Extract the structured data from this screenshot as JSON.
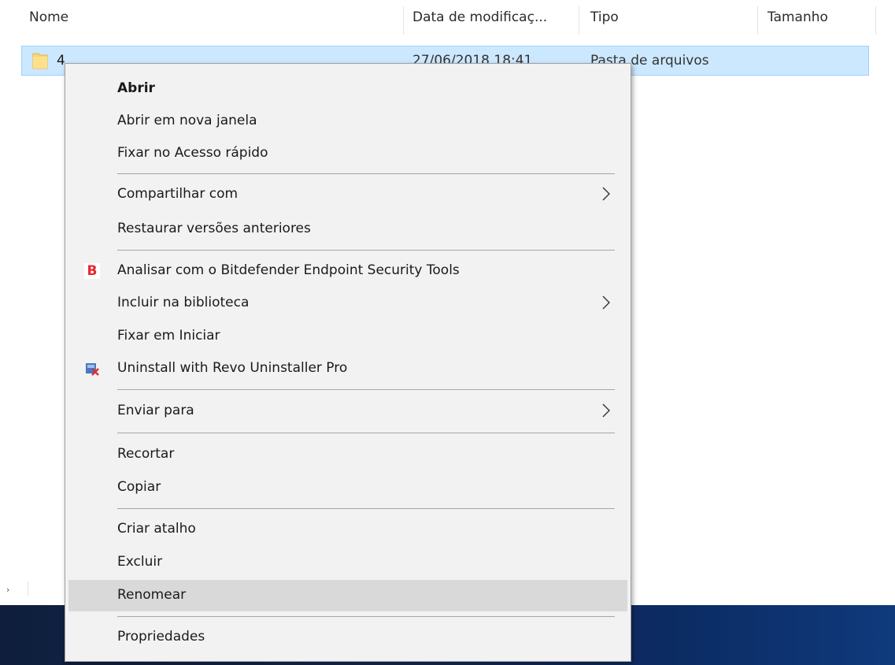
{
  "columns": {
    "name": "Nome",
    "date": "Data de modificaç...",
    "type": "Tipo",
    "size": "Tamanho"
  },
  "selected_row": {
    "name": "4",
    "date": "27/06/2018 18:41",
    "type": "Pasta de arquivos",
    "icon": "folder-icon"
  },
  "context_menu": {
    "open": "Abrir",
    "open_new_window": "Abrir em nova janela",
    "pin_quick_access": "Fixar no Acesso rápido",
    "share_with": "Compartilhar com",
    "restore_versions": "Restaurar versões anteriores",
    "bitdefender_scan": "Analisar com o Bitdefender Endpoint Security Tools",
    "bitdefender_icon_letter": "B",
    "include_library": "Incluir na biblioteca",
    "pin_start": "Fixar em Iniciar",
    "revo_uninstall": "Uninstall with Revo Uninstaller Pro",
    "send_to": "Enviar para",
    "cut": "Recortar",
    "copy": "Copiar",
    "create_shortcut": "Criar atalho",
    "delete": "Excluir",
    "rename": "Renomear",
    "properties": "Propriedades",
    "hovered_item": "Renomear"
  },
  "colors": {
    "selection_bg": "#cce8ff",
    "selection_border": "#99d1ff",
    "menu_bg": "#f2f2f2",
    "hover_bg": "#d9d9d9",
    "bitdefender_red": "#e8262c",
    "taskbar": "#0e1e3c"
  }
}
